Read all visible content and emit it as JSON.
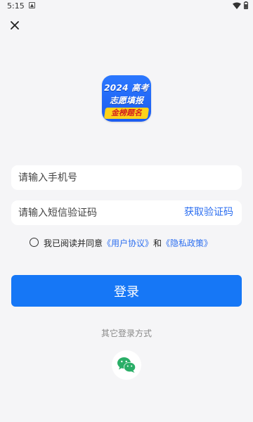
{
  "status_bar": {
    "time": "5:15",
    "icons": [
      "notification-icon",
      "wifi-icon",
      "battery-icon"
    ]
  },
  "logo": {
    "line1": "2024 高考",
    "line2": "志愿填报",
    "ribbon": "金榜题名",
    "colors": {
      "background": "#2b78ff",
      "ribbon": "#ffd21a",
      "ribbon_text": "#d21e1e"
    }
  },
  "form": {
    "phone_placeholder": "请输入手机号",
    "code_placeholder": "请输入短信验证码",
    "get_code_label": "获取验证码"
  },
  "agreement": {
    "prefix": "我已阅读并同意",
    "user_agreement": "《用户协议》",
    "conjunction": "和",
    "privacy_policy": "《隐私政策》"
  },
  "login_button": "登录",
  "other_login_label": "其它登录方式",
  "colors": {
    "primary": "#1677f6",
    "link": "#2d6ff0",
    "background": "#f5f5f7",
    "wechat_green": "#2aae67"
  }
}
